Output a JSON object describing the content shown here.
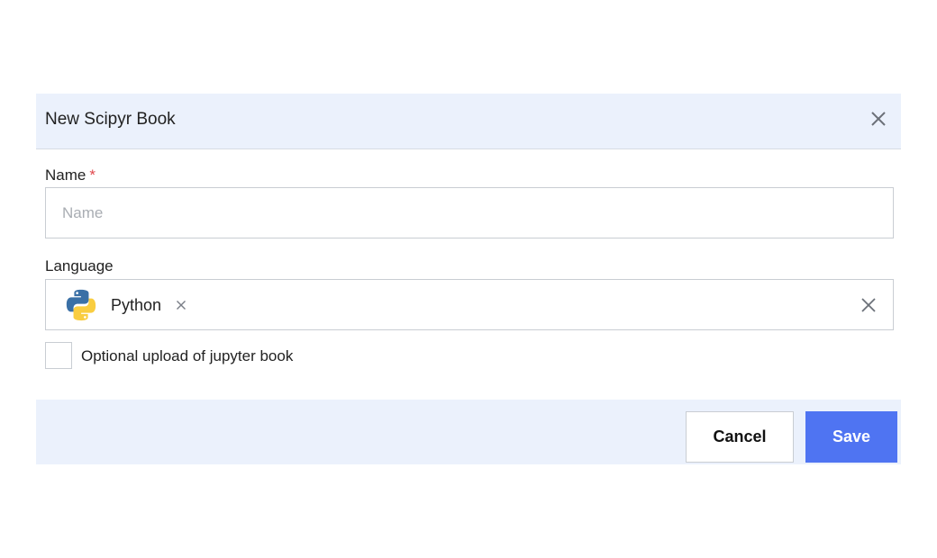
{
  "dialog": {
    "title": "New Scipyr Book",
    "close_icon": "close-icon"
  },
  "name_field": {
    "label": "Name",
    "required_marker": "*",
    "placeholder": "Name",
    "value": ""
  },
  "language_field": {
    "label": "Language",
    "selected": [
      {
        "label": "Python",
        "icon": "python-logo-icon",
        "remove_icon": "close-icon"
      }
    ],
    "clear_icon": "close-icon"
  },
  "upload_option": {
    "label": "Optional upload of jupyter book",
    "checked": false
  },
  "footer": {
    "cancel_label": "Cancel",
    "save_label": "Save"
  },
  "colors": {
    "header_bg": "#ebf1fc",
    "primary": "#4f74f2",
    "required": "#e0474c",
    "border": "#c9cdd3",
    "placeholder": "#a9adb3"
  }
}
